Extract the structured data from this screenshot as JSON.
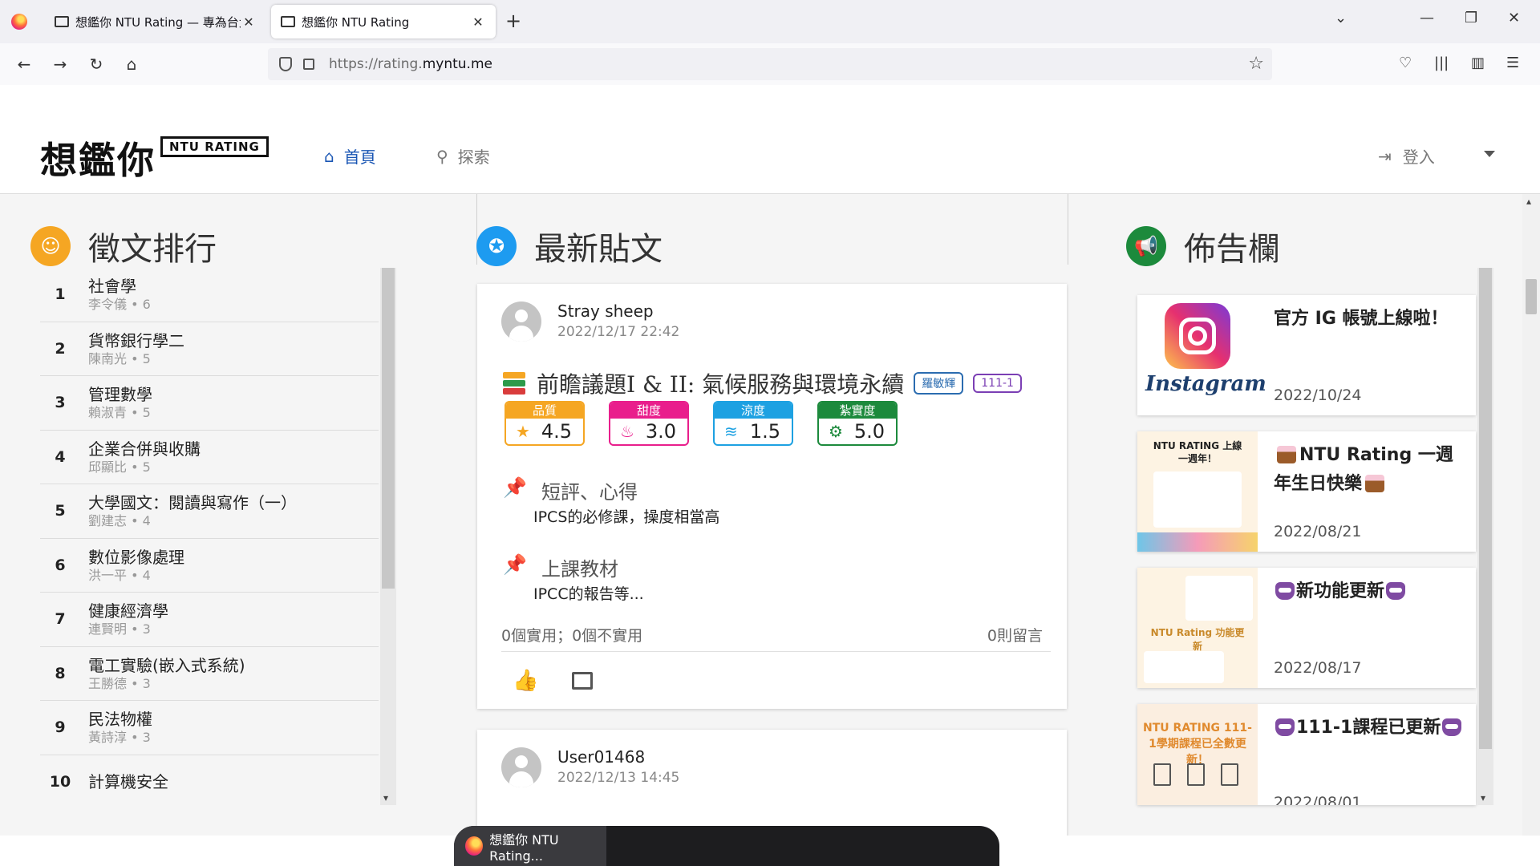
{
  "browser": {
    "tabs": [
      {
        "title": "想鑑你 NTU Rating — 專為台大",
        "active": false
      },
      {
        "title": "想鑑你 NTU Rating",
        "active": true
      }
    ],
    "new_tab": "+",
    "url_prefix": "https://rating.",
    "url_domain": "myntu.me"
  },
  "header": {
    "logo_text": "想鑑你",
    "logo_badge": "NTU RATING",
    "nav_home": "首頁",
    "nav_search": "探索",
    "login": "登入"
  },
  "ranking": {
    "title": "徵文排行",
    "accent": "#f5a623",
    "items": [
      {
        "rank": "1",
        "course": "社會學",
        "sub": "李令儀 • 6"
      },
      {
        "rank": "2",
        "course": "貨幣銀行學二",
        "sub": "陳南光 • 5"
      },
      {
        "rank": "3",
        "course": "管理數學",
        "sub": "賴淑青 • 5"
      },
      {
        "rank": "4",
        "course": "企業合併與收購",
        "sub": "邱顯比 • 5"
      },
      {
        "rank": "5",
        "course": "大學國文：閱讀與寫作（一）",
        "sub": "劉建志 • 4"
      },
      {
        "rank": "6",
        "course": "數位影像處理",
        "sub": "洪一平 • 4"
      },
      {
        "rank": "7",
        "course": "健康經濟學",
        "sub": "連賢明 • 3"
      },
      {
        "rank": "8",
        "course": "電工實驗(嵌入式系統)",
        "sub": "王勝德 • 3"
      },
      {
        "rank": "9",
        "course": "民法物權",
        "sub": "黃詩淳 • 3"
      },
      {
        "rank": "10",
        "course": "計算機安全",
        "sub": ""
      }
    ]
  },
  "posts": {
    "title": "最新貼文",
    "accent": "#1d9bf0",
    "items": [
      {
        "author": "Stray sheep",
        "date": "2022/12/17 22:42",
        "course": "前瞻議題I & II: 氣候服務與環境永續",
        "professor": "羅敏輝",
        "semester": "111-1",
        "ratings": [
          {
            "label": "品質",
            "value": "4.5",
            "color": "#f5a623",
            "icon": "★"
          },
          {
            "label": "甜度",
            "value": "3.0",
            "color": "#e91e8c",
            "icon": "♨"
          },
          {
            "label": "涼度",
            "value": "1.5",
            "color": "#1da1e2",
            "icon": "≋"
          },
          {
            "label": "紮實度",
            "value": "5.0",
            "color": "#1c8a3c",
            "icon": "⚙"
          }
        ],
        "short_review_title": "短評、心得",
        "short_review": "IPCS的必修課，操度相當高",
        "material_title": "上課教材",
        "material": "IPCC的報告等...",
        "useful": "0個實用；0個不實用",
        "comments": "0則留言"
      },
      {
        "author": "User01468",
        "date": "2022/12/13 14:45"
      }
    ]
  },
  "announcements": {
    "title": "佈告欄",
    "accent": "#1c8a3c",
    "items": [
      {
        "title": "官方 IG 帳號上線啦！",
        "date": "2022/10/24",
        "thumb_text": "Instagram"
      },
      {
        "title": "NTU Rating 一週年生日快樂",
        "date": "2022/08/21",
        "thumb_text": "NTU RATING 上線一週年！"
      },
      {
        "title": "新功能更新",
        "date": "2022/08/17",
        "thumb_text": "NTU Rating 功能更新"
      },
      {
        "title": "111-1課程已更新",
        "date": "2022/08/01",
        "thumb_text": "NTU RATING 111-1學期課程已全數更新！"
      }
    ]
  },
  "taskbar": {
    "app_label": "想鑑你 NTU Rating..."
  }
}
